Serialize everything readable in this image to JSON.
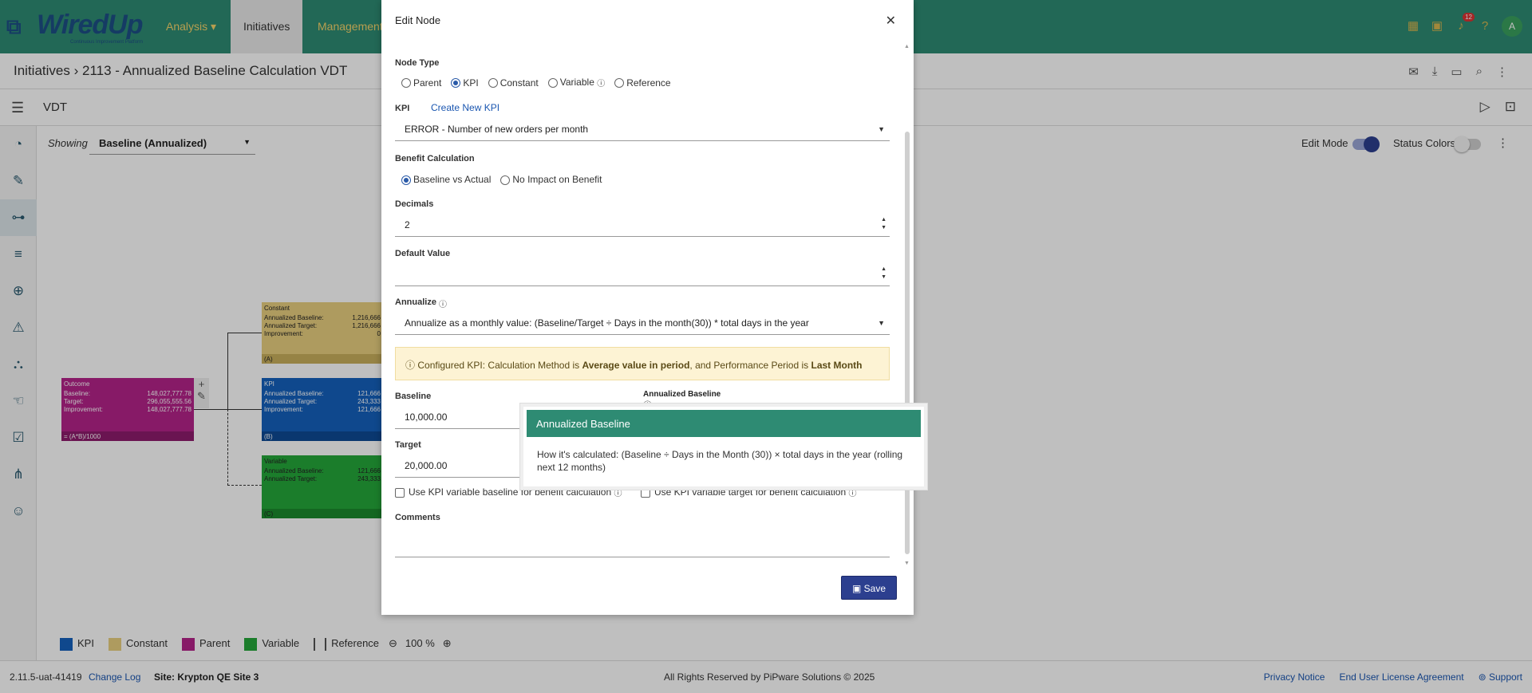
{
  "app": {
    "logo_text": "WiredUp",
    "logo_tagline": "Continuous Improvement Platform"
  },
  "nav": {
    "items": [
      {
        "label": "Analysis ▾"
      },
      {
        "label": "Initiatives"
      },
      {
        "label": "Management"
      }
    ],
    "notification_count": "12",
    "avatar_initial": "A"
  },
  "breadcrumb": {
    "root": "Initiatives",
    "current": "2113 - Annualized Baseline Calculation VDT"
  },
  "subheader": {
    "title": "VDT"
  },
  "canvas": {
    "showing_label": "Showing",
    "showing_value": "Baseline (Annualized)",
    "edit_mode_label": "Edit Mode",
    "edit_mode_on": true,
    "status_colors_label": "Status Colors",
    "status_colors_on": false,
    "nodes": {
      "outcome": {
        "title": "Outcome",
        "rows": [
          {
            "k": "Baseline:",
            "v": "148,027,777.78"
          },
          {
            "k": "Target:",
            "v": "296,055,555.56"
          },
          {
            "k": "Improvement:",
            "v": "148,027,777.78"
          }
        ],
        "formula": "= (A*B)/1000"
      },
      "constant": {
        "title": "Constant",
        "rows": [
          {
            "k": "Annualized Baseline:",
            "v": "1,216,666"
          },
          {
            "k": "Annualized Target:",
            "v": "1,216,666"
          },
          {
            "k": "Improvement:",
            "v": "0"
          }
        ],
        "tag": "(A)"
      },
      "kpi": {
        "title": "KPI",
        "rows": [
          {
            "k": "Annualized Baseline:",
            "v": "121,666"
          },
          {
            "k": "Annualized Target:",
            "v": "243,333"
          },
          {
            "k": "Improvement:",
            "v": "121,666"
          }
        ],
        "tag": "(B)"
      },
      "variable": {
        "title": "Variable",
        "rows": [
          {
            "k": "Annualized Baseline:",
            "v": "121,666"
          },
          {
            "k": "Annualized Target:",
            "v": "243,333"
          }
        ],
        "tag": "(C)"
      }
    },
    "legend": [
      {
        "label": "KPI",
        "color": "#1560bd"
      },
      {
        "label": "Constant",
        "color": "#e8cf7f"
      },
      {
        "label": "Parent",
        "color": "#b4238a"
      },
      {
        "label": "Variable",
        "color": "#25a73a"
      },
      {
        "label": "Reference",
        "color": ""
      }
    ],
    "zoom": "100 %"
  },
  "modal": {
    "title": "Edit Node",
    "node_type_label": "Node Type",
    "node_types": [
      "Parent",
      "KPI",
      "Constant",
      "Variable",
      "Reference"
    ],
    "node_type_selected": "KPI",
    "kpi_label": "KPI",
    "create_kpi_link": "Create New KPI",
    "kpi_value": "ERROR - Number of new orders per month",
    "benefit_label": "Benefit Calculation",
    "benefit_options": [
      "Baseline vs Actual",
      "No Impact on Benefit"
    ],
    "benefit_selected": "Baseline vs Actual",
    "decimals_label": "Decimals",
    "decimals_value": "2",
    "default_value_label": "Default Value",
    "default_value": "",
    "annualize_label": "Annualize",
    "annualize_value": "Annualize as a monthly value: (Baseline/Target ÷ Days in the month(30)) * total days in the year",
    "alert": {
      "prefix": "Configured KPI: Calculation Method is ",
      "method": "Average value in period",
      "middle": ", and Performance Period is ",
      "period": "Last Month"
    },
    "baseline_label": "Baseline",
    "baseline_value": "10,000.00",
    "target_label": "Target",
    "target_value": "20,000.00",
    "use_var_baseline": "Use KPI variable baseline for benefit calculation",
    "use_var_target": "Use KPI variable target for benefit calculation",
    "comments_label": "Comments",
    "save_label": "Save"
  },
  "tooltip": {
    "tab_label": "Annualized Baseline",
    "header": "Annualized Baseline",
    "body": "How it's calculated: (Baseline ÷ Days in the Month (30)) × total days in the year (rolling next 12 months)"
  },
  "footer": {
    "version": "2.11.5-uat-41419",
    "changelog": "Change Log",
    "site": "Site: Krypton QE Site 3",
    "rights": "All Rights Reserved by PiPware Solutions © 2025",
    "privacy": "Privacy Notice",
    "eula": "End User License Agreement",
    "support": "Support"
  },
  "colors": {
    "brand": "#2e8b73",
    "nav_text": "#f5d36a",
    "save_button": "#2c3f8f"
  }
}
